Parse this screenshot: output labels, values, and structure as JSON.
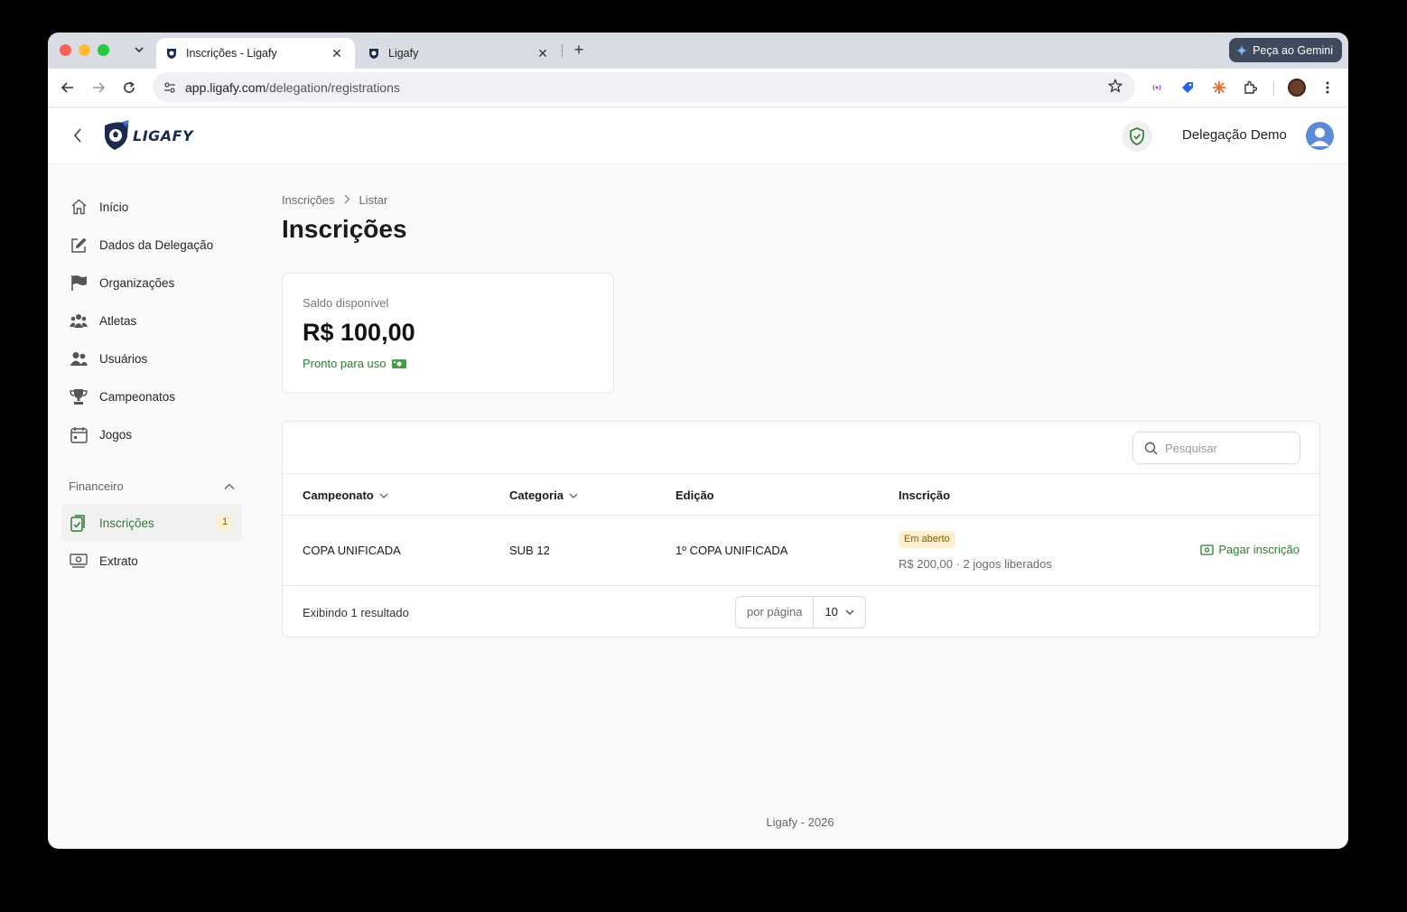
{
  "browser": {
    "tabs": [
      {
        "title": "Inscrições - Ligafy",
        "active": true
      },
      {
        "title": "Ligafy",
        "active": false
      }
    ],
    "gemini_label": "Peça ao Gemini",
    "url_host": "app.ligafy.com",
    "url_path": "/delegation/registrations"
  },
  "header": {
    "logo_text": "LIGAFY",
    "delegation_name": "Delegação Demo"
  },
  "sidebar": {
    "items": [
      {
        "label": "Início",
        "icon": "home-icon"
      },
      {
        "label": "Dados da Delegação",
        "icon": "edit-icon"
      },
      {
        "label": "Organizações",
        "icon": "flag-icon"
      },
      {
        "label": "Atletas",
        "icon": "group-icon"
      },
      {
        "label": "Usuários",
        "icon": "users-icon"
      },
      {
        "label": "Campeonatos",
        "icon": "trophy-icon"
      },
      {
        "label": "Jogos",
        "icon": "calendar-icon"
      }
    ],
    "section_label": "Financeiro",
    "finance_items": [
      {
        "label": "Inscrições",
        "icon": "clipboard-icon",
        "badge": "1",
        "active": true
      },
      {
        "label": "Extrato",
        "icon": "money-icon"
      }
    ]
  },
  "main": {
    "breadcrumb": [
      "Inscrições",
      "Listar"
    ],
    "title": "Inscrições",
    "balance": {
      "label": "Saldo disponível",
      "value": "R$ 100,00",
      "status": "Pronto para uso"
    },
    "search_placeholder": "Pesquisar",
    "columns": [
      "Campeonato",
      "Categoria",
      "Edição",
      "Inscrição"
    ],
    "rows": [
      {
        "campeonato": "COPA UNIFICADA",
        "categoria": "SUB 12",
        "edicao": "1º COPA UNIFICADA",
        "status": "Em aberto",
        "info": "R$ 200,00 · 2 jogos liberados",
        "action": "Pagar inscrição"
      }
    ],
    "result_text": "Exibindo 1 resultado",
    "per_page_label": "por página",
    "per_page_value": "10"
  },
  "footer": "Ligafy - 2026",
  "colors": {
    "accent_green": "#2e7d32",
    "badge_bg": "#fdf0d0"
  }
}
